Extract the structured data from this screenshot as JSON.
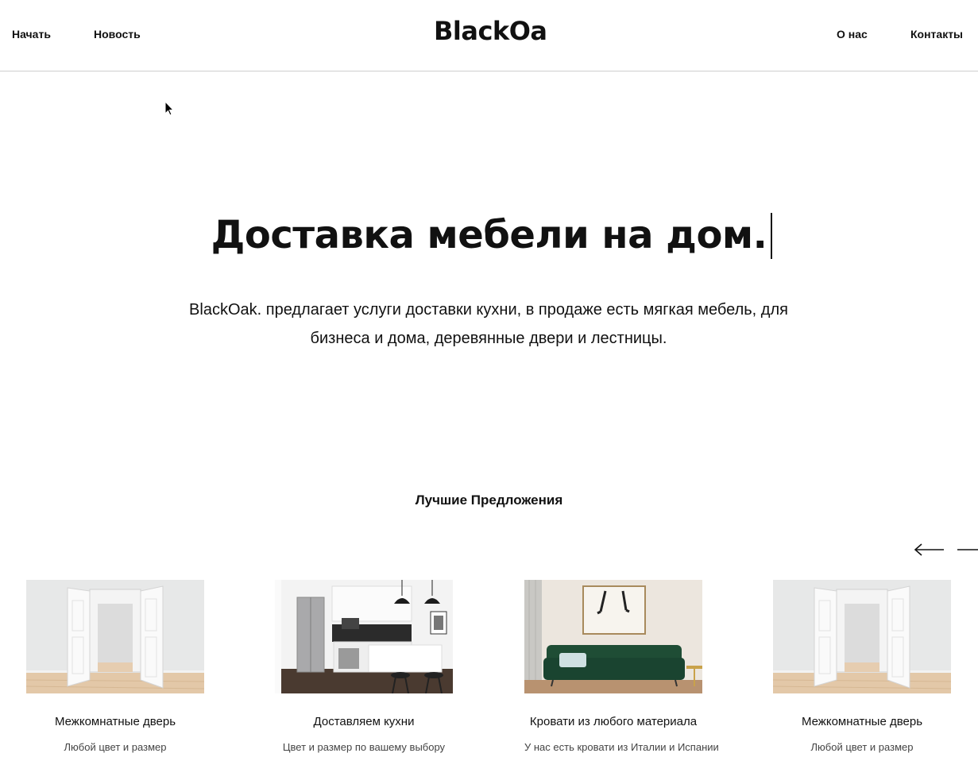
{
  "header": {
    "nav_left": [
      "Начать",
      "Новость"
    ],
    "logo": "BlackOak.",
    "nav_right": [
      "О нас",
      "Контакты"
    ]
  },
  "hero": {
    "title": "Доставка мебели на дом.",
    "description": "BlackOak. предлагает услуги доставки кухни, в продаже есть мягкая мебель, для бизнеса и дома, деревянные двери и лестницы."
  },
  "offers": {
    "title": "Лучшие Предложения",
    "prev_icon": "arrow-left-icon",
    "next_icon": "arrow-right-icon",
    "cards": [
      {
        "title": "Межкомнатные дверь",
        "subtitle": "Любой цвет и размер",
        "image": "open-doors-photo"
      },
      {
        "title": "Доставляем кухни",
        "subtitle": "Цвет и размер по вашему выбору",
        "image": "kitchen-photo"
      },
      {
        "title": "Кровати из любого материала",
        "subtitle": "У нас есть кровати из Италии и Испании",
        "image": "green-sofa-photo"
      },
      {
        "title": "Межкомнатные дверь",
        "subtitle": "Любой цвет и размер",
        "image": "open-doors-photo"
      }
    ]
  },
  "colors": {
    "text": "#111111",
    "background": "#ffffff",
    "divider": "#cfcfcf",
    "sofa": "#1f4d35"
  }
}
